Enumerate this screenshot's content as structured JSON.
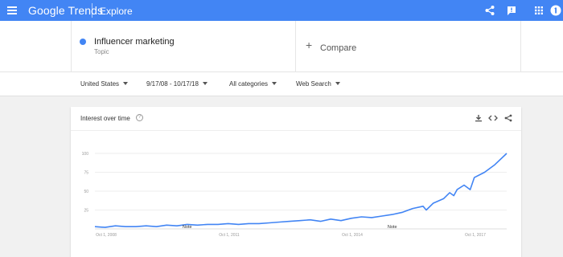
{
  "topbar": {
    "brand_google": "Google",
    "brand_trends": "Trends",
    "section": "Explore",
    "icons": [
      "menu-icon",
      "share-icon",
      "feedback-icon",
      "apps-icon",
      "account-icon"
    ]
  },
  "search": {
    "term": {
      "name": "Influencer marketing",
      "type": "Topic",
      "color": "#4285f4"
    },
    "compare_label": "Compare"
  },
  "filters": [
    {
      "label": "United States"
    },
    {
      "label": "9/17/08 - 10/17/18"
    },
    {
      "label": "All categories"
    },
    {
      "label": "Web Search"
    }
  ],
  "card": {
    "title": "Interest over time",
    "icons": [
      "help-icon",
      "download-icon",
      "embed-icon",
      "share-icon"
    ]
  },
  "chart_data": {
    "type": "line",
    "title": "Interest over time",
    "xlabel": "",
    "ylabel": "",
    "xlim": [
      2008.75,
      2018.79
    ],
    "ylim": [
      0,
      100
    ],
    "yticks": [
      25,
      50,
      75,
      100
    ],
    "xtick_labels": [
      {
        "x": 2008.75,
        "label": "Oct 1, 2008"
      },
      {
        "x": 2011.75,
        "label": "Oct 1, 2011"
      },
      {
        "x": 2014.75,
        "label": "Oct 1, 2014"
      },
      {
        "x": 2017.75,
        "label": "Oct 1, 2017"
      }
    ],
    "notes": [
      {
        "x": 2011.0,
        "label": "Note"
      },
      {
        "x": 2016.0,
        "label": "Note"
      }
    ],
    "grid": true,
    "color": "#4285f4",
    "series": [
      {
        "x": [
          2008.75,
          2009.0,
          2009.25,
          2009.5,
          2009.75,
          2010.0,
          2010.25,
          2010.5,
          2010.75,
          2011.0,
          2011.25,
          2011.5,
          2011.75,
          2012.0,
          2012.25,
          2012.5,
          2012.75,
          2013.0,
          2013.25,
          2013.5,
          2013.75,
          2014.0,
          2014.25,
          2014.5,
          2014.75,
          2015.0,
          2015.25,
          2015.5,
          2015.75,
          2016.0,
          2016.25,
          2016.5,
          2016.75,
          2016.83,
          2017.0,
          2017.25,
          2017.4,
          2017.5,
          2017.58,
          2017.75,
          2017.9,
          2018.0,
          2018.25,
          2018.5,
          2018.79
        ],
        "values": [
          3,
          2,
          4,
          3,
          3,
          4,
          3,
          5,
          4,
          6,
          5,
          6,
          6,
          7,
          6,
          7,
          7,
          8,
          9,
          10,
          11,
          12,
          10,
          13,
          11,
          14,
          16,
          15,
          17,
          19,
          22,
          27,
          30,
          25,
          34,
          40,
          48,
          44,
          52,
          58,
          52,
          68,
          75,
          85,
          100
        ]
      }
    ]
  }
}
